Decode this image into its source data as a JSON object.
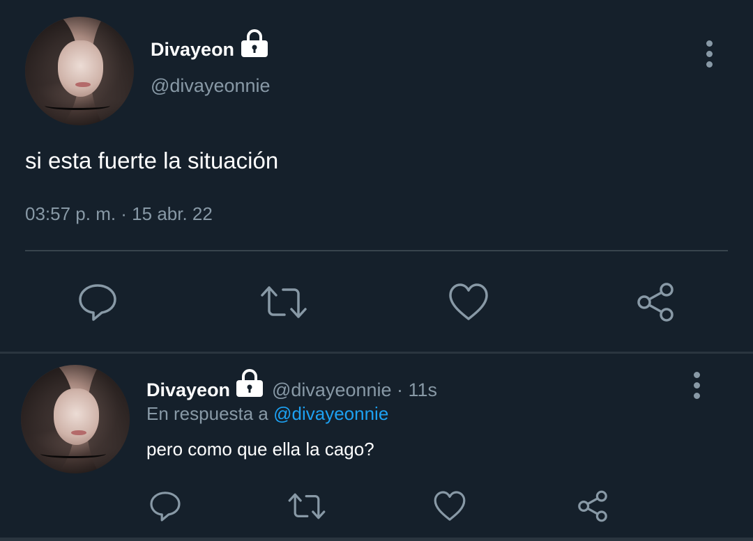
{
  "main_tweet": {
    "display_name": "Divayeon",
    "handle": "@divayeonnie",
    "text": "si esta fuerte la situación",
    "timestamp": "03:57 p. m. · 15 abr. 22"
  },
  "reply_tweet": {
    "display_name": "Divayeon",
    "handle_time": "@divayeonnie · 11s",
    "reply_prefix": "En respuesta a",
    "reply_mention": "@divayeonnie",
    "text": "pero como que ella la cago?"
  },
  "icons": [
    "lock-icon",
    "more-options-icon",
    "reply-icon",
    "retweet-icon",
    "like-icon",
    "share-icon"
  ],
  "colors": {
    "background": "#15202b",
    "secondary_text": "#8899a6",
    "accent": "#1da1f2",
    "divider": "#38444d"
  }
}
